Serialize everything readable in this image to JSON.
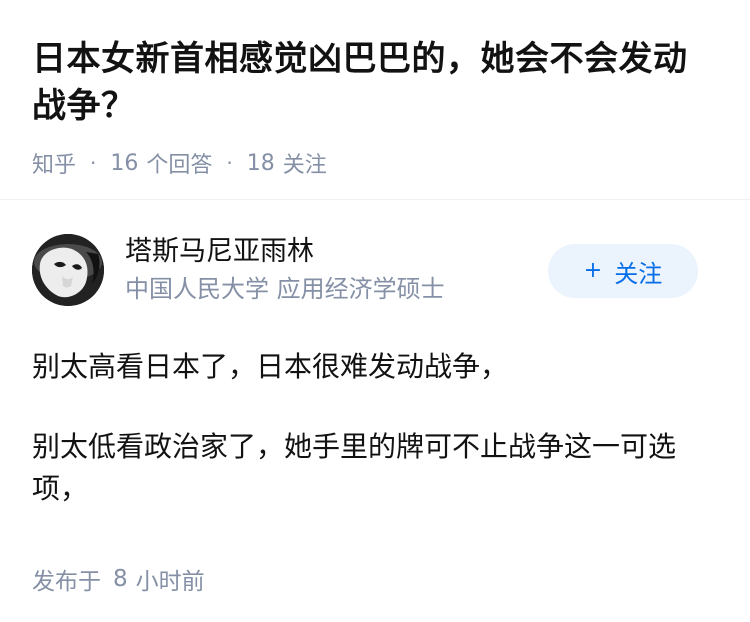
{
  "question": {
    "title": "日本女新首相感觉凶巴巴的，她会不会发动战争？",
    "source": "知乎",
    "answer_count": "16",
    "answer_unit": "个回答",
    "follower_count": "18",
    "follower_unit": "关注",
    "separator": "·"
  },
  "answer": {
    "author": {
      "avatar_icon": "mask-avatar-icon",
      "name": "塔斯马尼亚雨林",
      "headline": "中国人民大学 应用经济学硕士"
    },
    "follow_button": {
      "icon": "plus-icon",
      "icon_glyph": "+",
      "label": "关注"
    },
    "paragraphs": [
      "别太高看日本了，日本很难发动战争，",
      "别太低看政治家了，她手里的牌可不止战争这一可选项，"
    ],
    "published": {
      "prefix": "发布于",
      "count": "8",
      "suffix": "小时前"
    }
  },
  "colors": {
    "text_primary": "#121212",
    "text_secondary": "#8590a6",
    "accent": "#056de8",
    "button_bg": "#ebf3fc"
  }
}
